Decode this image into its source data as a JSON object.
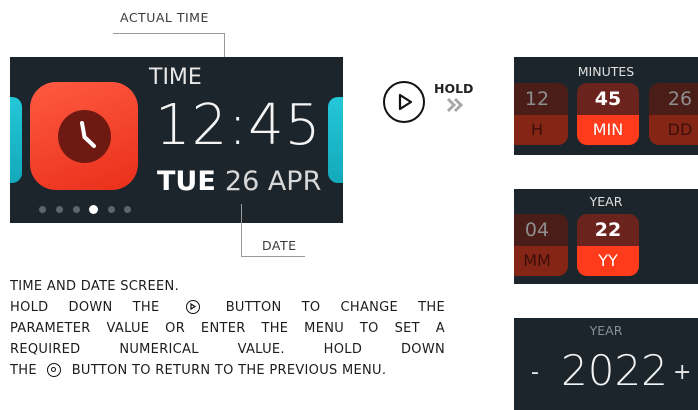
{
  "callouts": {
    "actual_time": "ACTUAL TIME",
    "date": "DATE"
  },
  "main_screen": {
    "title": "TIME",
    "hours": "12",
    "colon": ":",
    "minutes": "45",
    "day_of_week": "TUE",
    "date": "26 APR",
    "pager": {
      "count": 6,
      "active_index": 3
    },
    "app_icon": "clock-icon"
  },
  "hold": {
    "label": "HOLD",
    "button_icon": "play-circle-icon",
    "arrows_icon": "double-chevron-right-icon"
  },
  "panels": {
    "minutes": {
      "title": "MINUTES",
      "cells": [
        {
          "value": "12",
          "unit": "H",
          "state": "dim"
        },
        {
          "value": "45",
          "unit": "MIN",
          "state": "active"
        },
        {
          "value": "26",
          "unit": "DD",
          "state": "dim"
        }
      ]
    },
    "year_select": {
      "title": "YEAR",
      "cells": [
        {
          "value": "04",
          "unit": "MM",
          "state": "dim"
        },
        {
          "value": "22",
          "unit": "YY",
          "state": "active"
        }
      ]
    },
    "year_edit": {
      "title": "YEAR",
      "minus": "-",
      "value": "2022",
      "plus": "+"
    }
  },
  "description": {
    "line1": "TIME AND DATE SCREEN.",
    "line2a": "HOLD DOWN THE",
    "line2b": "BUTTON TO CHANGE THE",
    "line3": "PARAMETER VALUE OR ENTER THE MENU TO SET A",
    "line4": "REQUIRED NUMERICAL VALUE. HOLD DOWN",
    "line5a": "THE",
    "line5b": "BUTTON TO RETURN TO THE PREVIOUS MENU."
  }
}
